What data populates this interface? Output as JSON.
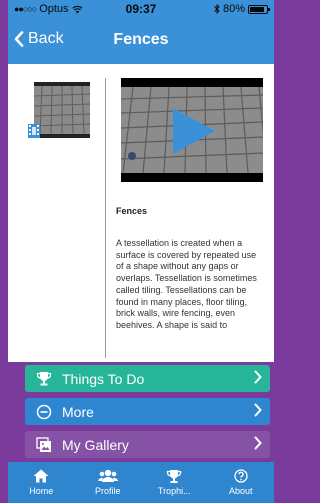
{
  "status_bar": {
    "carrier": "Optus",
    "time": "09:37",
    "battery": "80%"
  },
  "nav": {
    "back_label": "Back",
    "title": "Fences"
  },
  "content": {
    "article_title": "Fences",
    "article_body": "A tessellation is created when a surface is covered by repeated use of a shape without any gaps or overlaps. Tessellation is sometimes called tiling. Tessellations can be found in many places, floor tiling, brick walls, wire fencing, even beehives. A shape is said to"
  },
  "menu": [
    {
      "label": "Things To Do",
      "icon": "trophy-icon",
      "color": "#27b59a"
    },
    {
      "label": "More",
      "icon": "minus-circle-icon",
      "color": "#2e86d0"
    },
    {
      "label": "My Gallery",
      "icon": "gallery-icon",
      "color": "#8652a5"
    }
  ],
  "tabs": [
    {
      "label": "Home",
      "icon": "home-icon"
    },
    {
      "label": "Profile",
      "icon": "users-icon"
    },
    {
      "label": "Trophi...",
      "icon": "trophy-icon"
    },
    {
      "label": "About",
      "icon": "question-icon"
    }
  ],
  "colors": {
    "background": "#7b3b9c",
    "nav": "#3a91d8",
    "tab_bar": "#2f86cf",
    "play": "#3a91d8"
  }
}
